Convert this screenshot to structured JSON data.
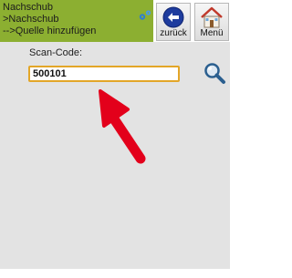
{
  "header": {
    "breadcrumb": [
      "Nachschub",
      ">Nachschub",
      "-->Quelle hinzufügen"
    ],
    "back_label": "zurück",
    "menu_label": "Menü"
  },
  "form": {
    "scan_label": "Scan-Code:",
    "scan_value": "500101"
  },
  "colors": {
    "header_green": "#8caf31",
    "input_border": "#e3a628",
    "back_icon": "#1e3c9e",
    "annotation_arrow": "#e3001b"
  },
  "icons": {
    "gear": "gear-icon",
    "back": "back-arrow-icon",
    "home": "home-icon",
    "search": "search-icon",
    "annotation": "red-arrow-annotation"
  }
}
